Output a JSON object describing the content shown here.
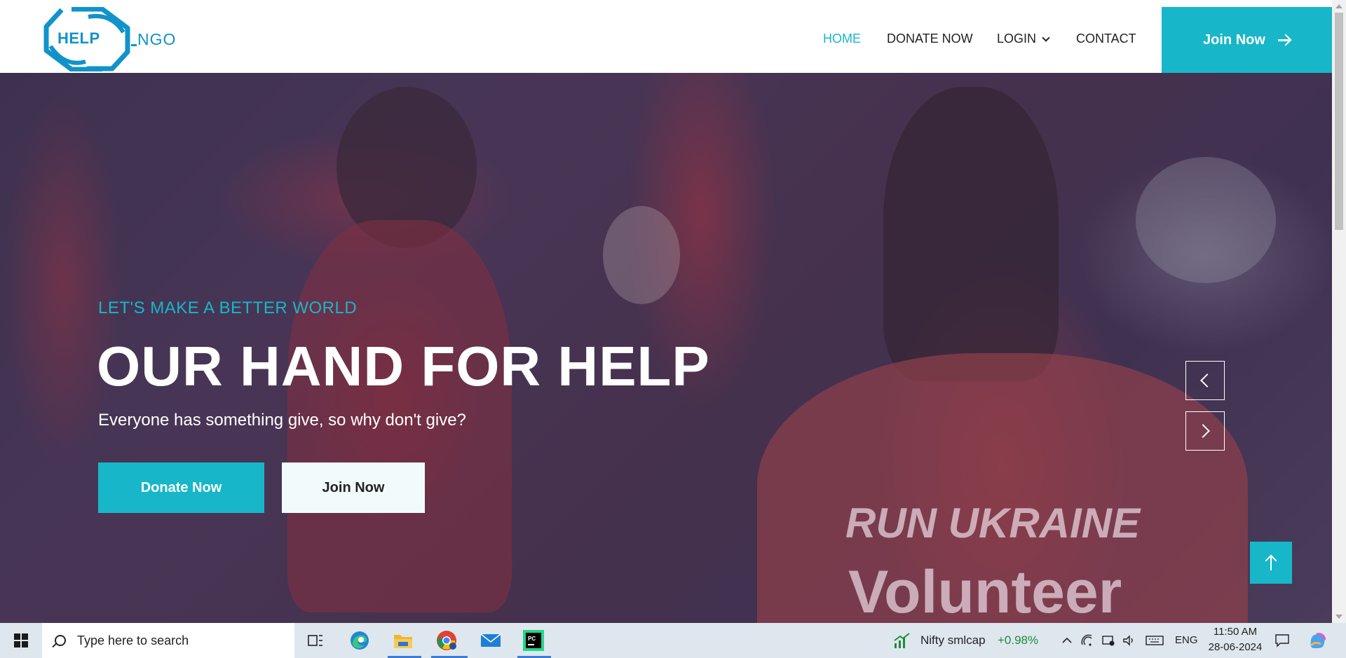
{
  "logo": {
    "mark_text": "HELP",
    "text": "NGO"
  },
  "nav": {
    "items": [
      {
        "label": "HOME",
        "active": true
      },
      {
        "label": "DONATE NOW"
      },
      {
        "label": "LOGIN"
      },
      {
        "label": "CONTACT"
      }
    ],
    "join_button": "Join Now"
  },
  "hero": {
    "subtitle": "LET'S MAKE A BETTER WORLD",
    "title": "OUR HAND FOR HELP",
    "text": "Everyone has something give, so why don't give?",
    "donate_button": "Donate Now",
    "join_button": "Join Now",
    "shirt_text_1": "RUN UKRAINE",
    "shirt_text_2": "Volunteer"
  },
  "taskbar": {
    "search_placeholder": "Type here to search",
    "stock_name": "Nifty smlcap",
    "stock_change": "+0.98%",
    "language": "ENG",
    "time": "11:50 AM",
    "date": "28-06-2024"
  },
  "colors": {
    "accent": "#17b7c9",
    "logo": "#1193c9",
    "stock_up": "#1e8a3c"
  }
}
